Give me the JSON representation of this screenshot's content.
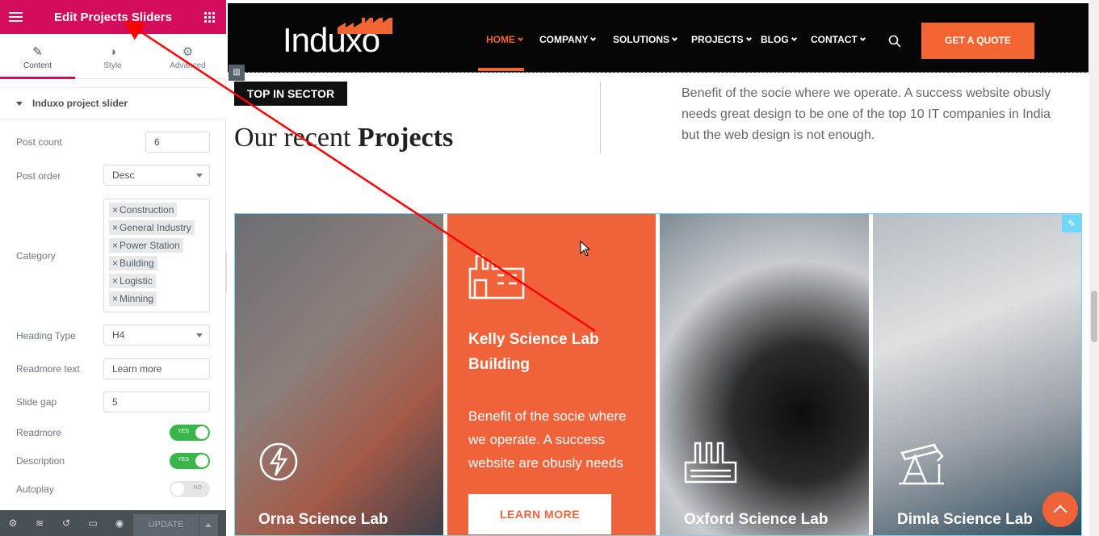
{
  "panel": {
    "title": "Edit Projects Sliders",
    "tabs": [
      {
        "label": "Content",
        "icon": "pencil-icon"
      },
      {
        "label": "Style",
        "icon": "contrast-icon"
      },
      {
        "label": "Advanced",
        "icon": "gear-icon"
      }
    ],
    "section_title": "Induxo project slider",
    "controls": {
      "post_count": {
        "label": "Post count",
        "value": "6"
      },
      "post_order": {
        "label": "Post order",
        "value": "Desc"
      },
      "category": {
        "label": "Category",
        "chips": [
          "Construction",
          "General Industry",
          "Power Station",
          "Building",
          "Logistic",
          "Minning"
        ]
      },
      "heading_type": {
        "label": "Heading Type",
        "value": "H4"
      },
      "readmore_text": {
        "label": "Readmore text",
        "value": "Learn more"
      },
      "slide_gap": {
        "label": "Slide gap",
        "value": "5"
      },
      "readmore": {
        "label": "Readmore",
        "state": "YES"
      },
      "description": {
        "label": "Description",
        "state": "YES"
      },
      "autoplay": {
        "label": "Autoplay",
        "state": "NO"
      }
    },
    "footer": {
      "update_label": "UPDATE"
    }
  },
  "site": {
    "logo": "Induxo",
    "nav": [
      "HOME",
      "COMPANY",
      "SOLUTIONS",
      "PROJECTS",
      "BLOG",
      "CONTACT"
    ],
    "quote_label": "GET A QUOTE",
    "tag": "TOP IN SECTOR",
    "heading_light": "Our recent ",
    "heading_bold": "Projects",
    "intro": "Benefit of the socie where we operate. A success website obusly needs great design to be one of the top 10 IT companies in India but the web design is not enough.",
    "cards": [
      {
        "title": "Orna Science Lab",
        "icon": "lightning-icon"
      },
      {
        "title": "Kelly Science Lab Building",
        "icon": "factory-icon",
        "description": "Benefit of the socie where we operate. A success website are obusly needs",
        "button": "LEARN MORE"
      },
      {
        "title": "Oxford Science Lab",
        "icon": "industry-icon"
      },
      {
        "title": "Dimla Science Lab",
        "icon": "oil-pump-icon"
      }
    ]
  },
  "colors": {
    "editor_accent": "#d30c5c",
    "brand_orange": "#f26532",
    "toggle_on": "#39b54a",
    "annotation": "#ff0000"
  }
}
